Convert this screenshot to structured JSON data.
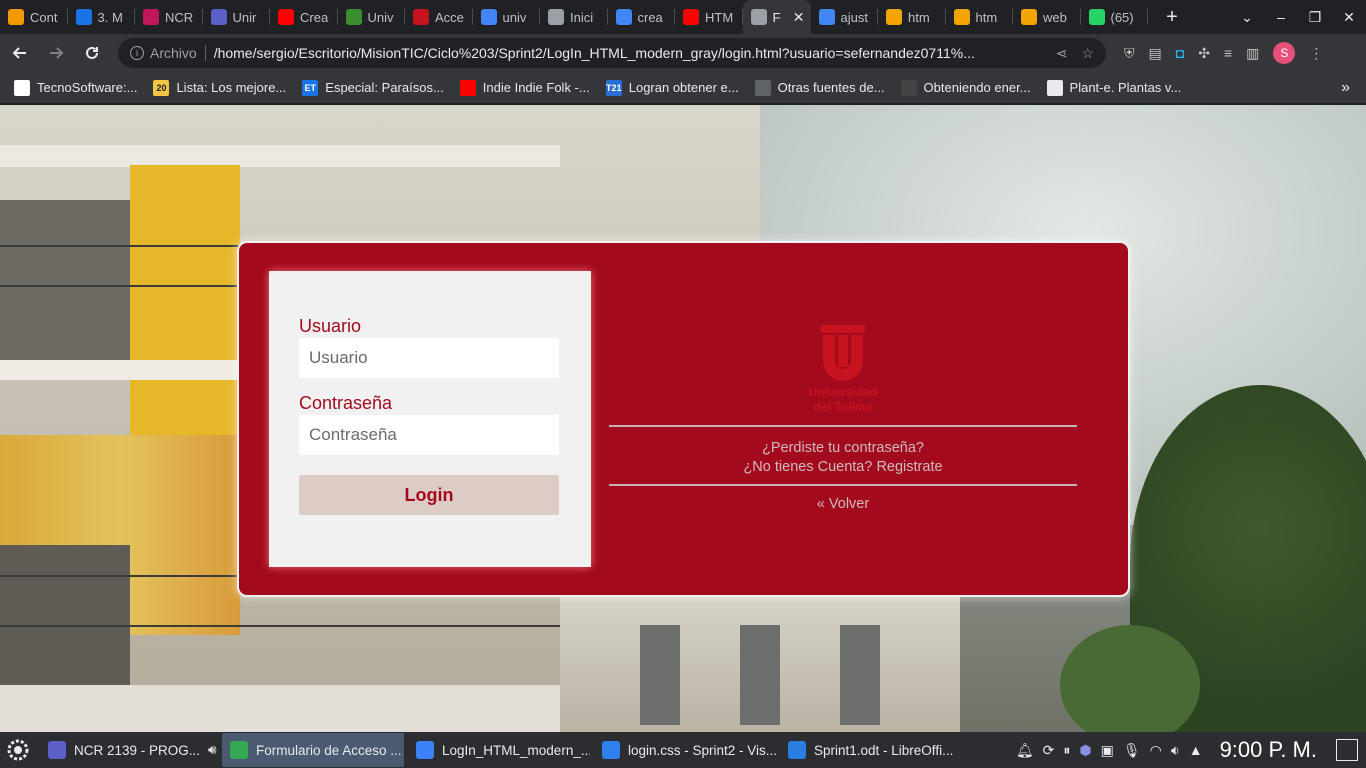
{
  "browser": {
    "tabs": [
      {
        "title": "Cont",
        "icon": "pencil-icon",
        "color": "#f29900"
      },
      {
        "title": "3. M",
        "icon": "cloud-icon",
        "color": "#1a73e8"
      },
      {
        "title": "NCR",
        "icon": "play-icon",
        "color": "#c2185b"
      },
      {
        "title": "Unir",
        "icon": "teams-icon",
        "color": "#5b5fc7"
      },
      {
        "title": "Crea",
        "icon": "youtube-icon",
        "color": "#ff0000"
      },
      {
        "title": "Univ",
        "icon": "wiki-icon",
        "color": "#3c8d2f"
      },
      {
        "title": "Acce",
        "icon": "ut-icon",
        "color": "#c7121f"
      },
      {
        "title": "univ",
        "icon": "google-icon",
        "color": "#4285f4"
      },
      {
        "title": "Inici",
        "icon": "globe-icon",
        "color": "#9aa0a6"
      },
      {
        "title": "crea",
        "icon": "google-icon",
        "color": "#4285f4"
      },
      {
        "title": "HTM",
        "icon": "youtube-icon",
        "color": "#ff0000"
      },
      {
        "title": "F",
        "icon": "globe-icon",
        "color": "#9aa0a6",
        "active": true
      },
      {
        "title": "ajust",
        "icon": "google-icon",
        "color": "#4285f4"
      },
      {
        "title": "htm",
        "icon": "stack-icon",
        "color": "#f4a400"
      },
      {
        "title": "htm",
        "icon": "stack-icon",
        "color": "#f4a400"
      },
      {
        "title": "web",
        "icon": "stack-icon",
        "color": "#f4a400"
      },
      {
        "title": "(65)",
        "icon": "whatsapp-icon",
        "color": "#25d366"
      }
    ],
    "address": {
      "label": "Archivo",
      "url": "/home/sergio/Escritorio/MisionTIC/Ciclo%203/Sprint2/LogIn_HTML_modern_gray/login.html?usuario=sefernandez0711%..."
    },
    "bookmarks": [
      {
        "label": "TecnoSoftware:...",
        "color": "#ffffff",
        "text_color": "#202124",
        "icon": "tecno-icon"
      },
      {
        "label": "Lista: Los mejore...",
        "color": "#f4c542",
        "text_color": "#202124",
        "badge": "20",
        "icon": "list-icon"
      },
      {
        "label": "Especial: Paraísos...",
        "color": "#1a73e8",
        "text_color": "#ffffff",
        "badge": "ET",
        "icon": "et-icon"
      },
      {
        "label": "Indie Indie Folk -...",
        "color": "#ff0000",
        "text_color": "#ffffff",
        "icon": "youtube-icon"
      },
      {
        "label": "Logran obtener e...",
        "color": "#2a6fd6",
        "text_color": "#ffffff",
        "badge": "T21",
        "icon": "t21-icon"
      },
      {
        "label": "Otras fuentes de...",
        "color": "#5f6368",
        "text_color": "#ffffff",
        "icon": "globe-icon"
      },
      {
        "label": "Obteniendo ener...",
        "color": "#444444",
        "text_color": "#ffffff",
        "icon": "energy-icon"
      },
      {
        "label": "Plant-e. Plantas v...",
        "color": "#e8eaed",
        "text_color": "#202124",
        "icon": "plant-icon"
      }
    ]
  },
  "login": {
    "user_label": "Usuario",
    "user_placeholder": "Usuario",
    "password_label": "Contraseña",
    "password_placeholder": "Contraseña",
    "login_button": "Login",
    "logo_line1": "Universidad",
    "logo_line2": "del Tolima",
    "forgot_link": "¿Perdiste tu contraseña?",
    "register_link": "¿No tienes Cuenta? Registrate",
    "back_link": "« Volver"
  },
  "taskbar": {
    "items": [
      {
        "label": "NCR 2139 - PROG...",
        "color": "#5b5fc7",
        "icon": "teams-icon"
      },
      {
        "label": "Formulario de Acceso ...",
        "color": "#34a853",
        "icon": "chrome-icon",
        "active": true
      },
      {
        "label": "LogIn_HTML_modern_...",
        "color": "#3b82f6",
        "icon": "folder-icon"
      },
      {
        "label": "login.css - Sprint2 - Vis...",
        "color": "#2f80ed",
        "icon": "vscode-icon"
      },
      {
        "label": "Sprint1.odt - LibreOffi...",
        "color": "#2a7de1",
        "icon": "writer-icon"
      }
    ],
    "clock": "9:00 P. M."
  },
  "colors": {
    "card_red": "#a30a1e",
    "logo_red": "#c7121f",
    "button_bg": "#ddccc5"
  }
}
